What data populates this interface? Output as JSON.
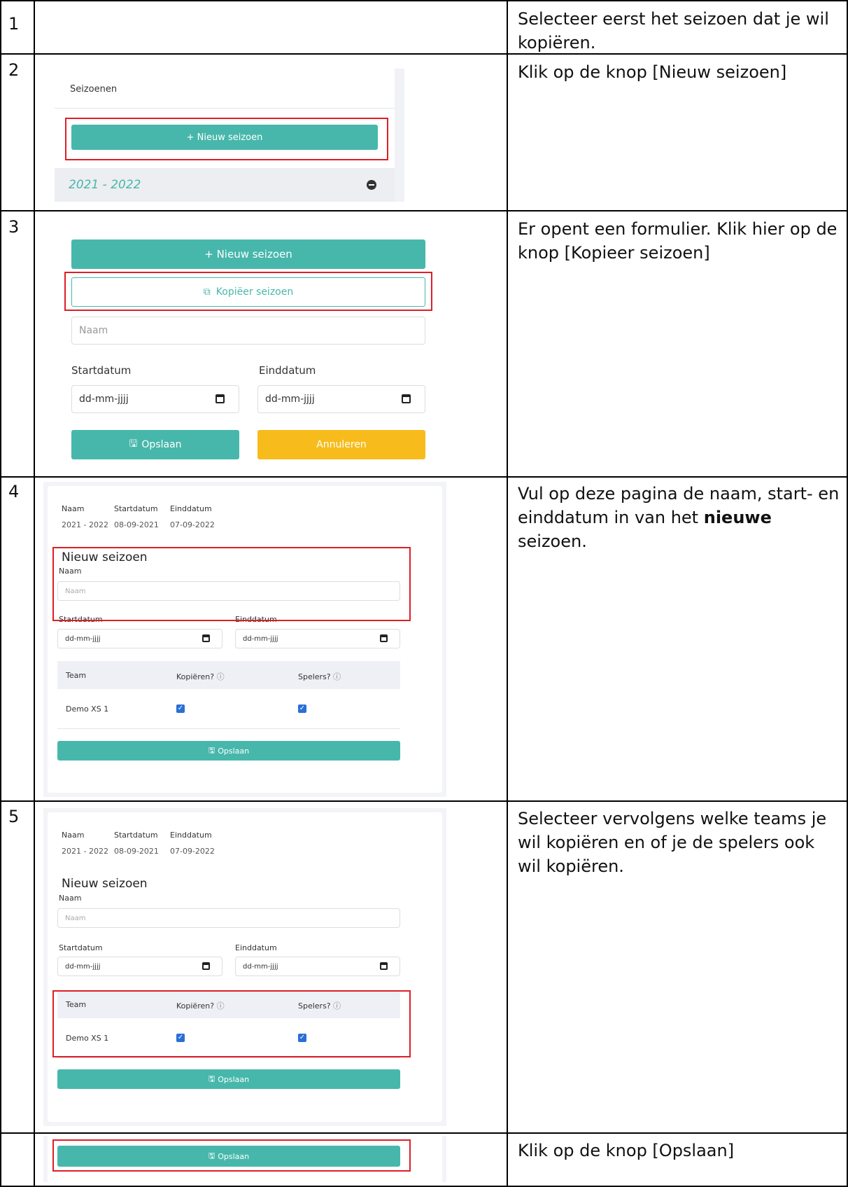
{
  "rows": [
    {
      "num": "1",
      "text": "Selecteer eerst het seizoen dat je wil kopiëren."
    },
    {
      "num": "2",
      "text": "Klik op de knop [Nieuw seizoen]"
    },
    {
      "num": "3",
      "text": "Er opent een formulier. Klik hier op de knop [Kopieer seizoen]"
    },
    {
      "num": "4",
      "text_before": "Vul op deze pagina de naam, start- en einddatum in van het ",
      "text_bold": "nieuwe",
      "text_after": " seizoen."
    },
    {
      "num": "5",
      "text": "Selecteer vervolgens welke teams je wil kopiëren en of je de spelers ook wil kopiëren."
    },
    {
      "num": "",
      "text": "Klik op de knop [Opslaan]"
    }
  ],
  "shot2": {
    "panel_title": "Seizoenen",
    "new_button": "+ Nieuw seizoen",
    "season_item": "2021 - 2022"
  },
  "shot3": {
    "new_button": "+ Nieuw seizoen",
    "copy_button": "Kopiëer seizoen",
    "name_placeholder": "Naam",
    "start_label": "Startdatum",
    "end_label": "Einddatum",
    "date_placeholder": "dd-mm-jjjj",
    "save_button": "Opslaan",
    "cancel_button": "Annuleren"
  },
  "season_form": {
    "col_name": "Naam",
    "col_start": "Startdatum",
    "col_end": "Einddatum",
    "src_name": "2021 - 2022",
    "src_start": "08-09-2021",
    "src_end": "07-09-2022",
    "heading": "Nieuw seizoen",
    "name_label": "Naam",
    "name_placeholder": "Naam",
    "start_label": "Startdatum",
    "end_label": "Einddatum",
    "date_placeholder": "dd-mm-jjjj",
    "th_team": "Team",
    "th_copy": "Kopiëren?",
    "th_players": "Spelers?",
    "team_name": "Demo XS 1",
    "save_button": "Opslaan"
  },
  "colors": {
    "teal": "#47b7ab",
    "yellow": "#f7bc1c",
    "highlight": "#dd1f26"
  }
}
